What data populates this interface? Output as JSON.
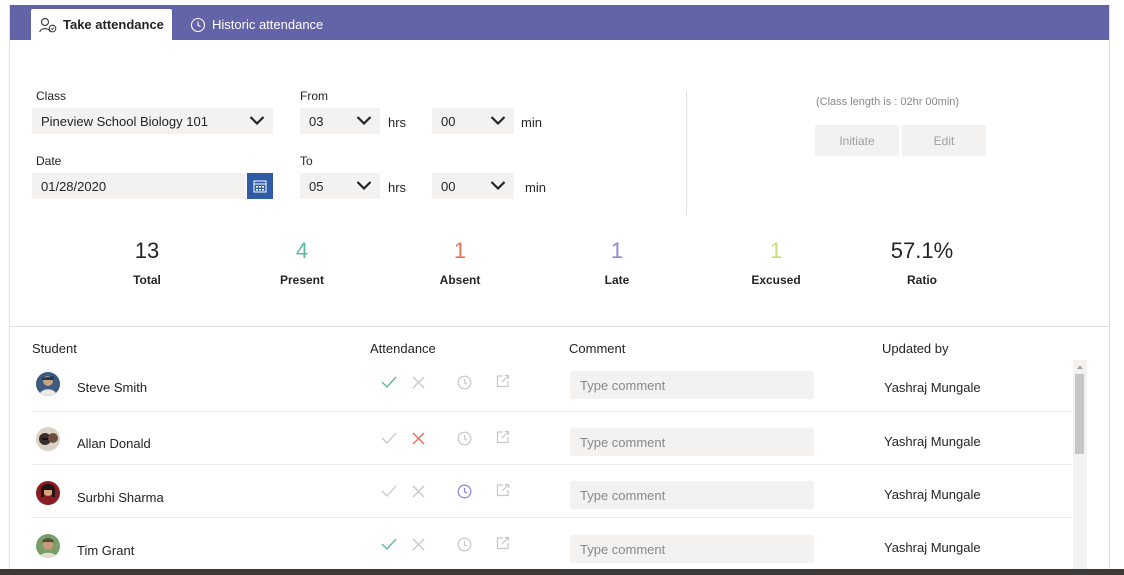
{
  "tabs": {
    "take": "Take attendance",
    "historic": "Historic attendance"
  },
  "form": {
    "class_label": "Class",
    "class_value": "Pineview School Biology 101",
    "from_label": "From",
    "from_hrs": "03",
    "from_min": "00",
    "to_label": "To",
    "to_hrs": "05",
    "to_min": "00",
    "hrs_unit": "hrs",
    "min_unit": "min",
    "date_label": "Date",
    "date_value": "01/28/2020",
    "class_length": "(Class length is : 02hr 00min)",
    "initiate_label": "Initiate",
    "edit_label": "Edit"
  },
  "stats": [
    {
      "value": "13",
      "label": "Total",
      "color": "#252423"
    },
    {
      "value": "4",
      "label": "Present",
      "color": "#5fb8a3"
    },
    {
      "value": "1",
      "label": "Absent",
      "color": "#e8735a"
    },
    {
      "value": "1",
      "label": "Late",
      "color": "#8b8cd9"
    },
    {
      "value": "1",
      "label": "Excused",
      "color": "#c9de7a"
    },
    {
      "value": "57.1%",
      "label": "Ratio",
      "color": "#252423"
    }
  ],
  "table": {
    "headers": {
      "student": "Student",
      "attendance": "Attendance",
      "comment": "Comment",
      "updated_by": "Updated by"
    },
    "rows": [
      {
        "name": "Steve Smith",
        "status": "present",
        "comment_placeholder": "Type comment",
        "updated_by": "Yashraj Mungale"
      },
      {
        "name": "Allan Donald",
        "status": "absent",
        "comment_placeholder": "Type comment",
        "updated_by": "Yashraj Mungale"
      },
      {
        "name": "Surbhi Sharma",
        "status": "late",
        "comment_placeholder": "Type comment",
        "updated_by": "Yashraj Mungale"
      },
      {
        "name": "Tim Grant",
        "status": "present",
        "comment_placeholder": "Type comment",
        "updated_by": "Yashraj Mungale"
      }
    ]
  },
  "icons": {
    "tab_take": "people-icon",
    "tab_historic": "history-clock-icon",
    "present": "check-icon",
    "absent": "x-icon",
    "late": "clock-icon",
    "excused": "export-icon",
    "calendar": "calendar-icon"
  },
  "colors": {
    "brand": "#6264a7",
    "present": "#5fb8a3",
    "absent": "#e8735a",
    "late": "#8b8cd9",
    "inactive_icon": "#c8c6c4",
    "calendar_button": "#2f5aa6"
  }
}
